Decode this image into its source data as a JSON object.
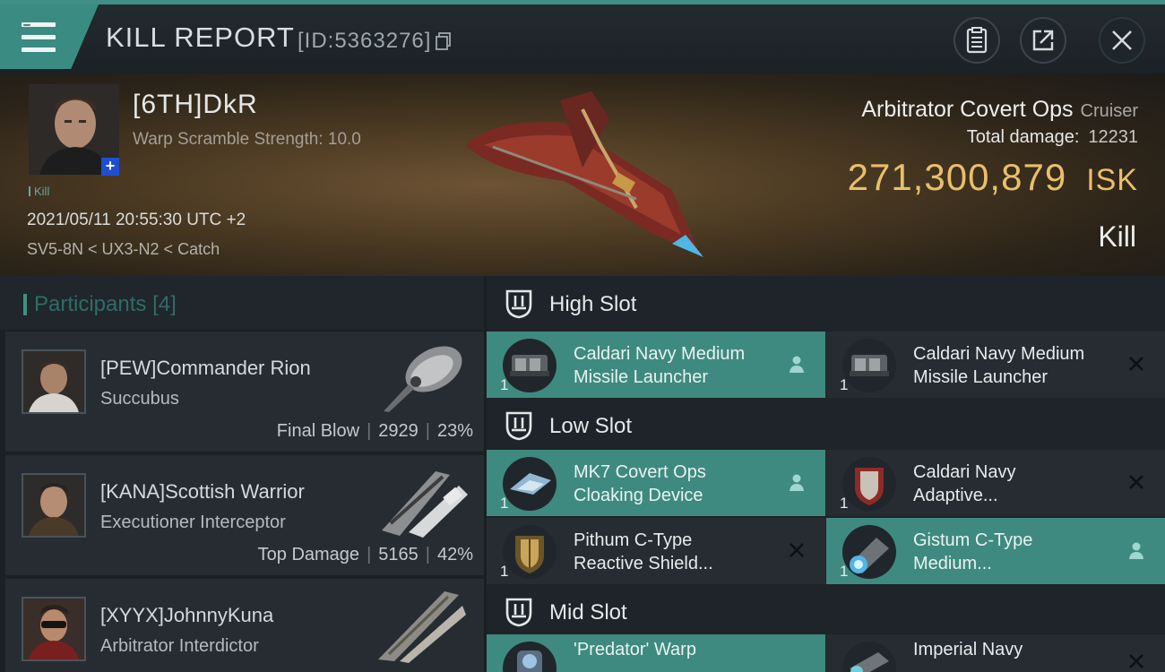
{
  "header": {
    "title": "KILL REPORT",
    "report_id": "[ID:5363276]",
    "icons": [
      "menu-icon",
      "copy-icon",
      "clipboard-icon",
      "share-icon",
      "close-icon"
    ]
  },
  "victim": {
    "pilot_name": "[6TH]DkR",
    "warp_scramble": "Warp Scramble Strength: 10.0",
    "kill_tag": "Kill",
    "datetime": "2021/05/11 20:55:30 UTC +2",
    "location": "SV5-8N < UX3-N2 < Catch",
    "ship_name": "Arbitrator Covert Ops",
    "ship_class": "Cruiser",
    "total_damage_label": "Total damage:",
    "total_damage_value": "12231",
    "isk_value": "271,300,879",
    "isk_unit": "ISK",
    "result": "Kill"
  },
  "participants": {
    "title": "Participants",
    "count": "[4]",
    "items": [
      {
        "name": "[PEW]Commander Rion",
        "ship": "Succubus",
        "role": "Final Blow",
        "damage": "2929",
        "percent": "23%"
      },
      {
        "name": "[KANA]Scottish Warrior",
        "ship": "Executioner Interceptor",
        "role": "Top Damage",
        "damage": "5165",
        "percent": "42%"
      },
      {
        "name": "[XYYX]JohnnyKuna",
        "ship": "Arbitrator Interdictor",
        "role": "",
        "damage": "",
        "percent": ""
      }
    ]
  },
  "slots": {
    "high": {
      "title": "High Slot",
      "modules": [
        {
          "name_line1": "Caldari Navy Medium",
          "name_line2": "Missile Launcher",
          "qty": "1",
          "state": "fitted"
        },
        {
          "name_line1": "Caldari Navy Medium",
          "name_line2": "Missile Launcher",
          "qty": "1",
          "state": "destroyed"
        }
      ]
    },
    "low": {
      "title": "Low Slot",
      "modules": [
        {
          "name_line1": "MK7 Covert Ops",
          "name_line2": "Cloaking Device",
          "qty": "1",
          "state": "fitted"
        },
        {
          "name_line1": "Caldari Navy",
          "name_line2": "Adaptive...",
          "qty": "1",
          "state": "destroyed"
        },
        {
          "name_line1": "Pithum C-Type",
          "name_line2": "Reactive Shield...",
          "qty": "1",
          "state": "destroyed"
        },
        {
          "name_line1": "Gistum C-Type",
          "name_line2": "Medium...",
          "qty": "1",
          "state": "fitted"
        }
      ]
    },
    "mid": {
      "title": "Mid Slot",
      "modules": [
        {
          "name_line1": "'Predator' Warp",
          "name_line2": "",
          "qty": "1",
          "state": "fitted"
        },
        {
          "name_line1": "Imperial Navy",
          "name_line2": "",
          "qty": "1",
          "state": "destroyed"
        }
      ]
    }
  },
  "colors": {
    "accent_teal": "#3e8a80",
    "isk_gold": "#e9bf6b"
  }
}
